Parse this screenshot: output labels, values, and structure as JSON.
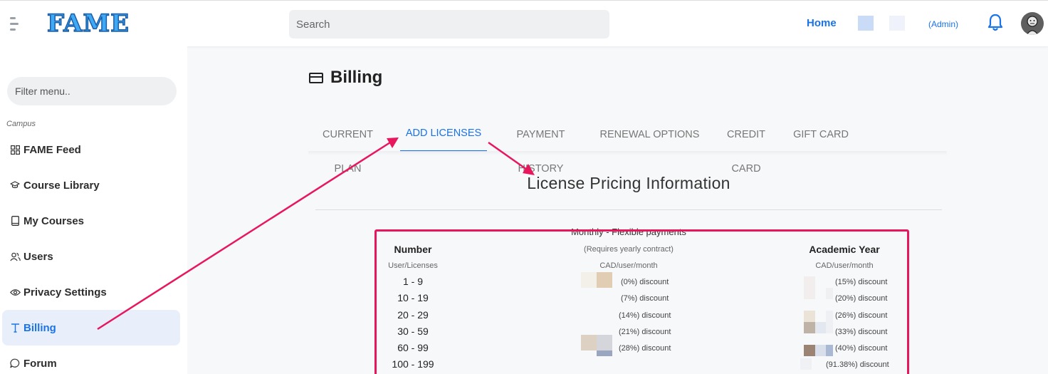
{
  "header": {
    "logo": "FAME",
    "search_placeholder": "Search",
    "home_label": "Home",
    "admin_label": "(Admin)"
  },
  "sidebar": {
    "filter_placeholder": "Filter menu..",
    "section_label": "Campus",
    "items": [
      {
        "label": "FAME Feed",
        "icon": "grid-icon"
      },
      {
        "label": "Course Library",
        "icon": "graduation-cap-icon"
      },
      {
        "label": "My Courses",
        "icon": "book-icon"
      },
      {
        "label": "Users",
        "icon": "users-icon"
      },
      {
        "label": "Privacy Settings",
        "icon": "eye-icon"
      },
      {
        "label": "Billing",
        "icon": "text-t-icon",
        "active": true
      },
      {
        "label": "Forum",
        "icon": "chat-bubble-icon"
      }
    ]
  },
  "main": {
    "title": "Billing",
    "tabs": [
      {
        "label": "CURRENT PLAN"
      },
      {
        "label": "ADD LICENSES",
        "active": true
      },
      {
        "label": "PAYMENT HISTORY"
      },
      {
        "label": "RENEWAL OPTIONS"
      },
      {
        "label": "CREDIT CARD"
      },
      {
        "label": "GIFT CARD"
      }
    ],
    "pricing_heading": "License Pricing Information",
    "table": {
      "monthly_title": "Monthly - Flexible payments",
      "monthly_note": "(Requires yearly contract)",
      "number_header": "Number",
      "number_sub": "User/Licenses",
      "monthly_unit": "CAD/user/month",
      "academic_header": "Academic Year",
      "academic_unit": "CAD/user/month",
      "rows": [
        {
          "range": "1 - 9",
          "monthly_discount": "(0%) discount",
          "academic_discount": "(15%) discount"
        },
        {
          "range": "10 - 19",
          "monthly_discount": "(7%) discount",
          "academic_discount": "(20%) discount"
        },
        {
          "range": "20 - 29",
          "monthly_discount": "(14%) discount",
          "academic_discount": "(26%) discount"
        },
        {
          "range": "30 - 59",
          "monthly_discount": "(21%) discount",
          "academic_discount": "(33%) discount"
        },
        {
          "range": "60 - 99",
          "monthly_discount": "(28%) discount",
          "academic_discount": "(40%) discount"
        },
        {
          "range": "100 - 199",
          "monthly_discount": "",
          "academic_discount": "(91.38%) discount"
        }
      ]
    }
  },
  "colors": {
    "accent": "#1a73e8",
    "annotation": "#e8175d",
    "active_nav_bg": "#e8effb"
  }
}
